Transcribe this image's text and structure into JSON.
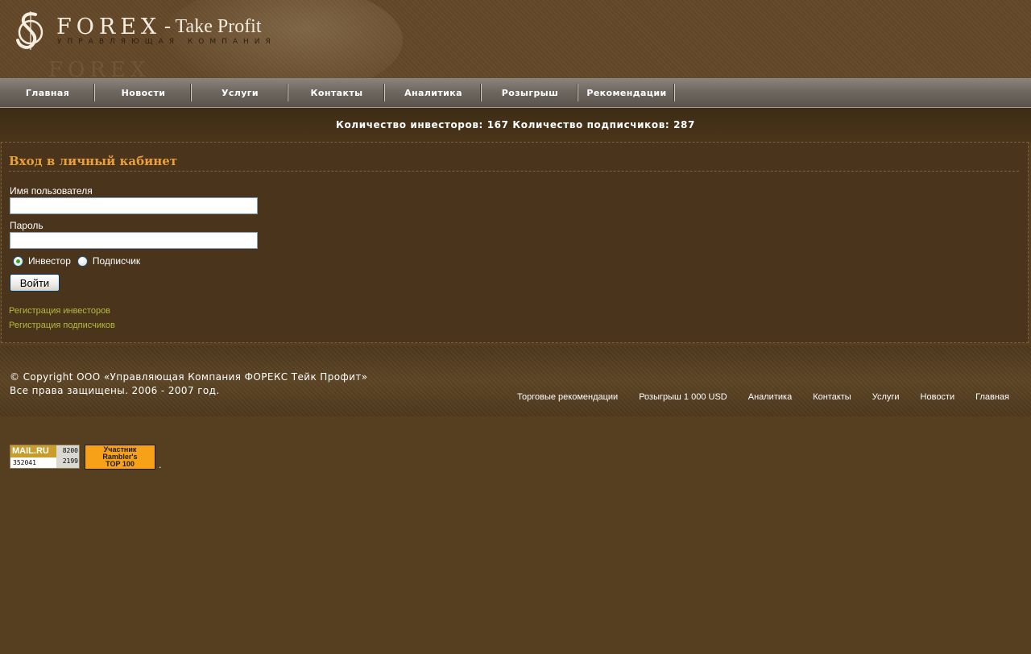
{
  "header": {
    "logo_title": "FOREX",
    "logo_suffix": "- Take Profit",
    "logo_subtitle": "УПРАВЛЯЮЩАЯ КОМПАНИЯ"
  },
  "nav": {
    "items": [
      "Главная",
      "Новости",
      "Услуги",
      "Контакты",
      "Аналитика",
      "Розыгрыш",
      "Рекомендации"
    ]
  },
  "stats": {
    "text": "Количество инвесторов: 167 Количество подписчиков: 287"
  },
  "login": {
    "title": "Вход в личный кабинет",
    "username_label": "Имя пользователя",
    "username_value": "",
    "password_label": "Пароль",
    "password_value": "",
    "role_options": [
      "Инвестор",
      "Подписчик"
    ],
    "role_selected": "Инвестор",
    "submit_label": "Войти",
    "links": [
      "Регистрация инвесторов",
      "Регистрация подписчиков"
    ]
  },
  "footer": {
    "copyright_line1": "© Copyright ООО «Управляющая Компания ФОРЕКС Тейк Профит»",
    "copyright_line2": "Все права защищены. 2006 - 2007 год.",
    "links": [
      "Торговые рекомендации",
      "Розыгрыш 1 000 USD",
      "Аналитика",
      "Контакты",
      "Услуги",
      "Новости",
      "Главная"
    ]
  },
  "counters": {
    "mail": {
      "logo": "MAIL.RU",
      "total": "352041",
      "top": "8200",
      "bottom": "2199"
    },
    "rambler": {
      "line1": "Участник",
      "line2": "Rambler's",
      "line3": "TOP 100"
    },
    "trailing": "."
  },
  "colors": {
    "background": "#563f20",
    "title_accent": "#e9a03a",
    "link_accent": "#b2bc3c"
  }
}
